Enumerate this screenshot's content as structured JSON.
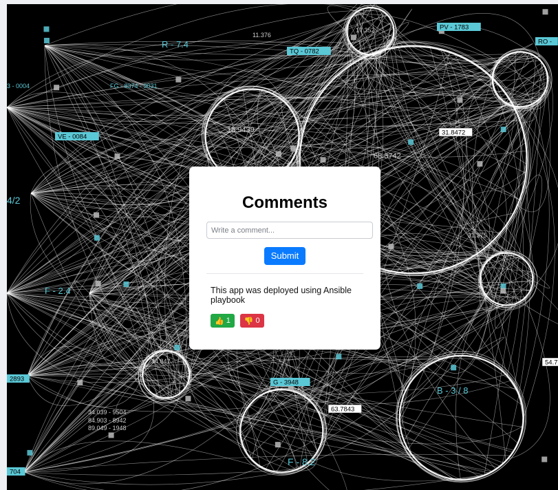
{
  "background": {
    "labels_boxed": [
      "TQ - 0782",
      "PV - 1783",
      "VE - 0084",
      "G - 3948",
      "RO -",
      "2893",
      "704"
    ],
    "labels_plain": [
      "R - 7.4",
      "3 - 0004",
      "FG - 8374 - 9031",
      "4/2",
      "F - 2.4",
      "B - 3 / 8",
      "F - 8.2",
      "11.376",
      "17.352",
      "15.9439",
      "68.3742",
      "31.375",
      "14.847",
      "34.039 - 9504",
      "84.903 - 8942",
      "89.049 - 1948"
    ],
    "labels_white_boxed": [
      "31.8472",
      "63.7843",
      "54.7"
    ],
    "colors": {
      "background": "#000000",
      "lines": "#ffffff",
      "accent": "#5bc8d6"
    }
  },
  "comments_panel": {
    "title": "Comments",
    "input": {
      "placeholder": "Write a comment...",
      "value": ""
    },
    "submit_label": "Submit",
    "comments": [
      {
        "text": "This app was deployed using Ansible playbook",
        "likes_icon": "thumbs-up-icon",
        "likes": "1",
        "dislikes_icon": "thumbs-down-icon",
        "dislikes": "0"
      }
    ],
    "colors": {
      "submit": "#0a7bff",
      "like": "#22a845",
      "dislike": "#dc3545"
    }
  }
}
